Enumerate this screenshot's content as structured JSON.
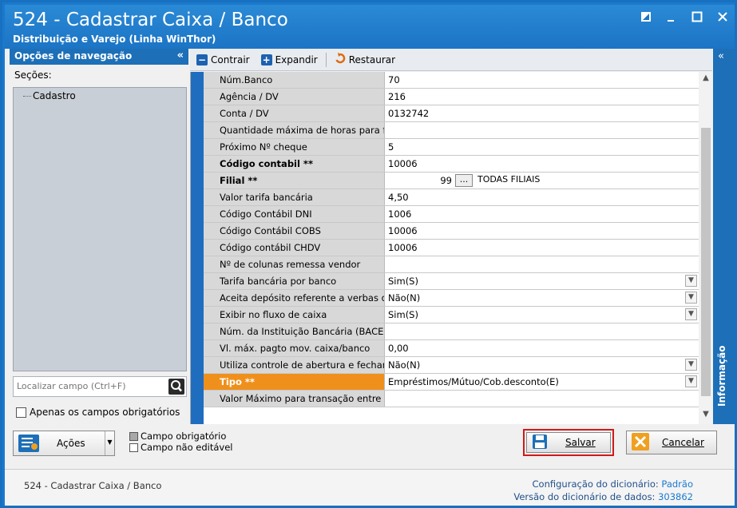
{
  "window": {
    "title": "524 - Cadastrar Caixa / Banco",
    "subtitle": "Distribuição e Varejo (Linha WinThor)",
    "controls": [
      "restore",
      "minimize",
      "maximize",
      "close"
    ]
  },
  "nav": {
    "header": "Opções de navegação",
    "collapse": "«",
    "sections_label": "Seções:",
    "items": [
      "Cadastro"
    ],
    "search_placeholder": "Localizar campo (Ctrl+F)",
    "only_required_label": "Apenas os campos obrigatórios"
  },
  "toolbar": {
    "contrair": "Contrair",
    "expandir": "Expandir",
    "restaurar": "Restaurar"
  },
  "info_panel": {
    "label": "Informação",
    "collapse": "«"
  },
  "grid": {
    "rows": [
      {
        "label": "Núm.Banco",
        "value": "70"
      },
      {
        "label": "Agência / DV",
        "value": "216"
      },
      {
        "label": "Conta / DV",
        "value": "0132742"
      },
      {
        "label": "Quantidade máxima de horas para fe",
        "value": ""
      },
      {
        "label": "Próximo Nº cheque",
        "value": "5"
      },
      {
        "label": "Código contabil **",
        "value": "10006"
      },
      {
        "label": "Filial **",
        "value": "99",
        "extra": "TODAS FILIAIS"
      },
      {
        "label": "Valor tarifa bancária",
        "value": "4,50"
      },
      {
        "label": "Código Contábil DNI",
        "value": "1006"
      },
      {
        "label": "Código Contábil COBS",
        "value": "10006"
      },
      {
        "label": "Código contábil CHDV",
        "value": "10006"
      },
      {
        "label": "Nº de colunas remessa vendor",
        "value": ""
      },
      {
        "label": "Tarifa bancária por banco",
        "value": "Sim(S)"
      },
      {
        "label": "Aceita depósito referente a verbas de",
        "value": "Não(N)"
      },
      {
        "label": "Exibir no fluxo de caixa",
        "value": "Sim(S)"
      },
      {
        "label": "Núm. da Instituição Bancária (BACEN)",
        "value": ""
      },
      {
        "label": "Vl. máx. pagto mov. caixa/banco",
        "value": "0,00"
      },
      {
        "label": "Utiliza controle de abertura e fechame",
        "value": "Não(N)"
      },
      {
        "label": "Tipo **",
        "value": "Empréstimos/Mútuo/Cob.desconto(E)"
      },
      {
        "label": "Valor Máximo para transação entre ba",
        "value": ""
      }
    ],
    "filial_button": "..."
  },
  "bottom": {
    "acoes": "Ações",
    "legend_required": "Campo obrigatório",
    "legend_readonly": "Campo não editável",
    "salvar": "Salvar",
    "cancelar": "Cancelar"
  },
  "status": {
    "left": "524 - Cadastrar Caixa / Banco",
    "config_label": "Configuração do dicionário:",
    "config_value": "Padrão",
    "version_label": "Versão do dicionário de dados:",
    "version_value": "303862"
  },
  "colors": {
    "title_blue": "#1c74c4",
    "selected_row": "#f0901c",
    "save_highlight": "#d01a1a"
  }
}
